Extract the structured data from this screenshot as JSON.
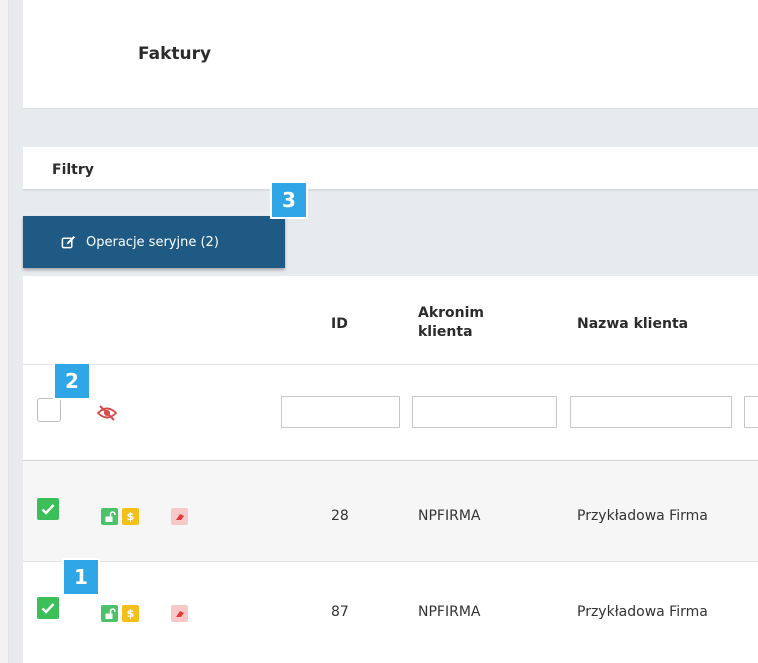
{
  "page": {
    "title": "Faktury"
  },
  "filters": {
    "label": "Filtry"
  },
  "bulk_actions": {
    "label": "Operacje seryjne (2)"
  },
  "table": {
    "columns": [
      {
        "key": "id",
        "label": "ID"
      },
      {
        "key": "acronym",
        "label": "Akronim klienta"
      },
      {
        "key": "client_name",
        "label": "Nazwa klienta"
      }
    ],
    "filter_inputs": {
      "id": "",
      "acronym": "",
      "client_name": ""
    },
    "rows": [
      {
        "checked": true,
        "id": "28",
        "acronym": "NPFIRMA",
        "client_name": "Przykładowa Firma"
      },
      {
        "checked": true,
        "id": "87",
        "acronym": "NPFIRMA",
        "client_name": "Przykładowa Firma"
      }
    ]
  },
  "badges": [
    "1",
    "2",
    "3"
  ],
  "icons": {
    "bulk_button": "edit-icon",
    "filter_toggle": "eye-slash-icon",
    "row_actions": [
      "unlock-icon",
      "dollar-icon",
      "eraser-icon"
    ]
  },
  "colors": {
    "primary": "#1f5a84",
    "badge": "#2fa7e6",
    "checkbox_checked": "#3cbf58",
    "action_unlock": "#4cc36a",
    "action_dollar": "#f2c018",
    "action_erase": "#f6c8c8",
    "eye_slash": "#d94a4a"
  }
}
